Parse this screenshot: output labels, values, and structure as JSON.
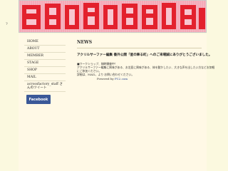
{
  "left_mark": "?",
  "nav": {
    "items": [
      {
        "label": "HOME"
      },
      {
        "label": "ABOUT"
      },
      {
        "label": "MEMBER"
      },
      {
        "label": "STAGE"
      },
      {
        "label": "SHOP"
      },
      {
        "label": "MAIL"
      },
      {
        "label": "acrossfactory_staff さんのツイート"
      }
    ]
  },
  "facebook_label": "Facebook",
  "main": {
    "heading": "NEWS",
    "thanks": "アクリルサーファー編集 番外公開「星の降る町」へのご来場誠にありがとうございました。",
    "lines": [
      "■ワークショップ、随時開催中！",
      "アクリルサーファー編集に興味がある、お芝居に興味がある、体を動かしたい、大きな声を出したい方などお気軽",
      "にご参加ください。",
      "詳細は、MAIL、より お問い合わせください。"
    ],
    "powered_prefix": "Powered by",
    "powered_link": "FC2.com"
  }
}
